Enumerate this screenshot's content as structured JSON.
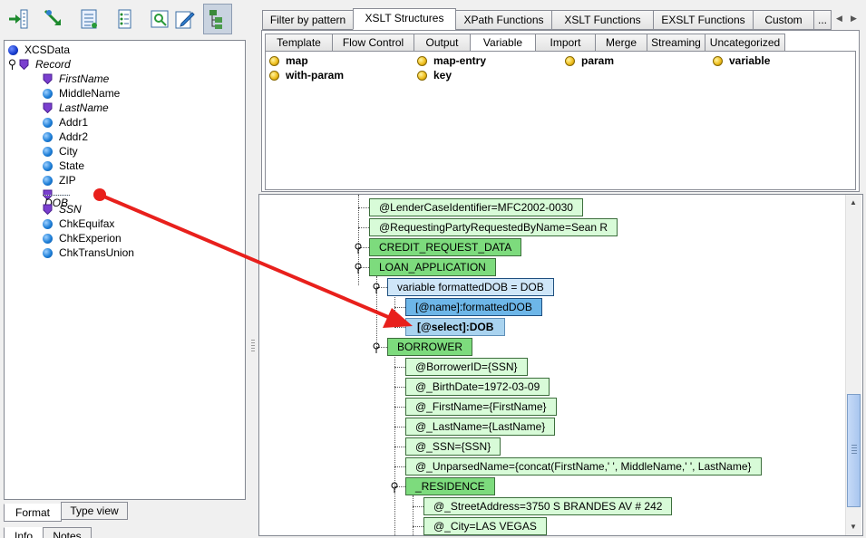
{
  "toolbar": {
    "icons": [
      "insert-node-icon",
      "auto-map-icon",
      "document-icon",
      "list-icon",
      "preview-icon",
      "edit-icon",
      "structure-icon"
    ],
    "selected_icon": "structure-icon"
  },
  "source_tree": {
    "root": "XCSData",
    "record": "Record",
    "fields": [
      {
        "label": "FirstName",
        "kind": "shield",
        "italic": true
      },
      {
        "label": "MiddleName",
        "kind": "ball",
        "italic": false
      },
      {
        "label": "LastName",
        "kind": "shield",
        "italic": true
      },
      {
        "label": "Addr1",
        "kind": "ball",
        "italic": false
      },
      {
        "label": "Addr2",
        "kind": "ball",
        "italic": false
      },
      {
        "label": "City",
        "kind": "ball",
        "italic": false
      },
      {
        "label": "State",
        "kind": "ball",
        "italic": false
      },
      {
        "label": "ZIP",
        "kind": "ball",
        "italic": false
      },
      {
        "label": "DOB",
        "kind": "shield",
        "italic": true,
        "highlighted": true
      },
      {
        "label": "SSN",
        "kind": "shield",
        "italic": true
      },
      {
        "label": "ChkEquifax",
        "kind": "ball",
        "italic": false
      },
      {
        "label": "ChkExperion",
        "kind": "ball",
        "italic": false
      },
      {
        "label": "ChkTransUnion",
        "kind": "ball",
        "italic": false
      }
    ]
  },
  "bottom_tabs": {
    "format": "Format",
    "type_view": "Type view",
    "info": "Info",
    "notes": "Notes"
  },
  "top_tabs": [
    "Filter by pattern",
    "XSLT Structures",
    "XPath Functions",
    "XSLT Functions",
    "EXSLT Functions",
    "Custom",
    "..."
  ],
  "top_tabs_active": "XSLT Structures",
  "sub_tabs": [
    "Template",
    "Flow Control",
    "Output",
    "Variable",
    "Import",
    "Merge",
    "Streaming",
    "Uncategorized"
  ],
  "sub_tabs_active": "Variable",
  "palette_items": [
    "map",
    "map-entry",
    "param",
    "variable",
    "with-param",
    "key"
  ],
  "mapping": {
    "n1": "@LenderCaseIdentifier=MFC2002-0030",
    "n2": "@RequestingPartyRequestedByName=Sean R",
    "n3": "CREDIT_REQUEST_DATA",
    "n4": "LOAN_APPLICATION",
    "n5": "variable formattedDOB = DOB",
    "n6": "[@name]:formattedDOB",
    "n7": "[@select]:DOB",
    "n8": "BORROWER",
    "n9": "@BorrowerID={SSN}",
    "n10": "@_BirthDate=1972-03-09",
    "n11": "@_FirstName={FirstName}",
    "n12": "@_LastName={LastName}",
    "n13": "@_SSN={SSN}",
    "n14": "@_UnparsedName={concat(FirstName,' ', MiddleName,' ', LastName}",
    "n15": "_RESIDENCE",
    "n16": "@_StreetAddress=3750 S BRANDES AV # 242",
    "n17": "@_City=LAS VEGAS"
  },
  "colors": {
    "arrow": "#e8201c",
    "node_light": "#d8fbd8",
    "node_medium": "#7ddb7d",
    "node_variable": "#cfe6f8",
    "node_name": "#6db6e8"
  }
}
